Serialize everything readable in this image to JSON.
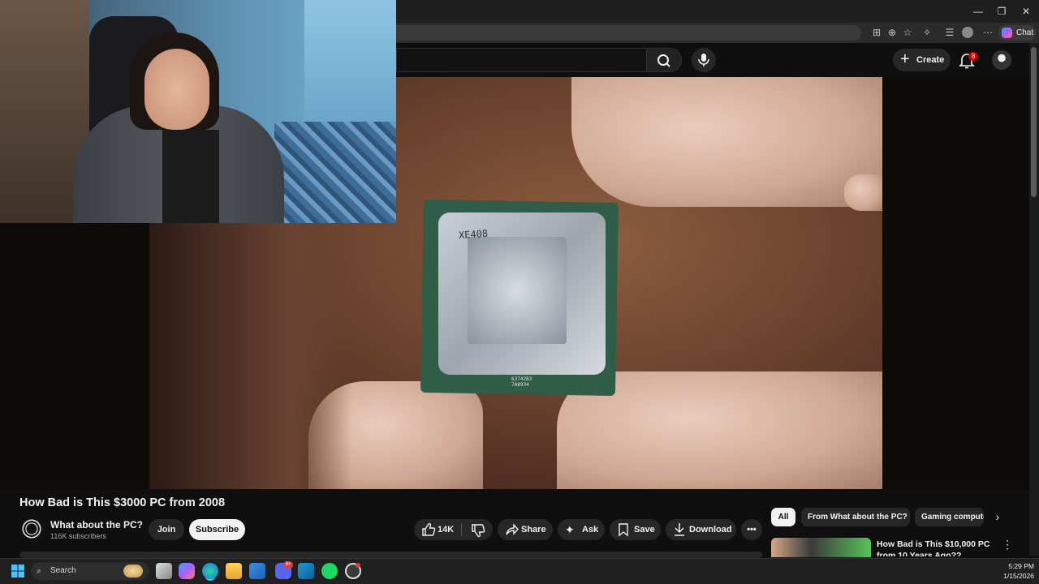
{
  "browser": {
    "chat_label": "Chat",
    "window_buttons": [
      "minimize",
      "restore",
      "close"
    ]
  },
  "masthead": {
    "create_label": "Create",
    "notification_count": "8"
  },
  "video": {
    "title": "How Bad is This $3000 PC from 2008",
    "cpu_marking": "XE408",
    "cpu_code": "63742B3\n7A8934"
  },
  "channel": {
    "name": "What about the PC?",
    "subscribers": "116K subscribers",
    "join_label": "Join",
    "subscribe_label": "Subscribe"
  },
  "actions": {
    "likes": "14K",
    "share": "Share",
    "ask": "Ask",
    "save": "Save",
    "download": "Download"
  },
  "related": {
    "chips": [
      "All",
      "From What about the PC?",
      "Gaming computers"
    ],
    "items": [
      {
        "title": "How Bad is This $10,000 PC from 10 Years Ago??"
      }
    ]
  },
  "taskbar": {
    "search_label": "Search",
    "discord_badge": "9+",
    "time": "5:29 PM",
    "date": "1/15/2026"
  },
  "colors": {
    "background": "#0f0f0f",
    "pill": "#272727",
    "notification_badge": "#cc0000",
    "taskbar": "#202020"
  }
}
